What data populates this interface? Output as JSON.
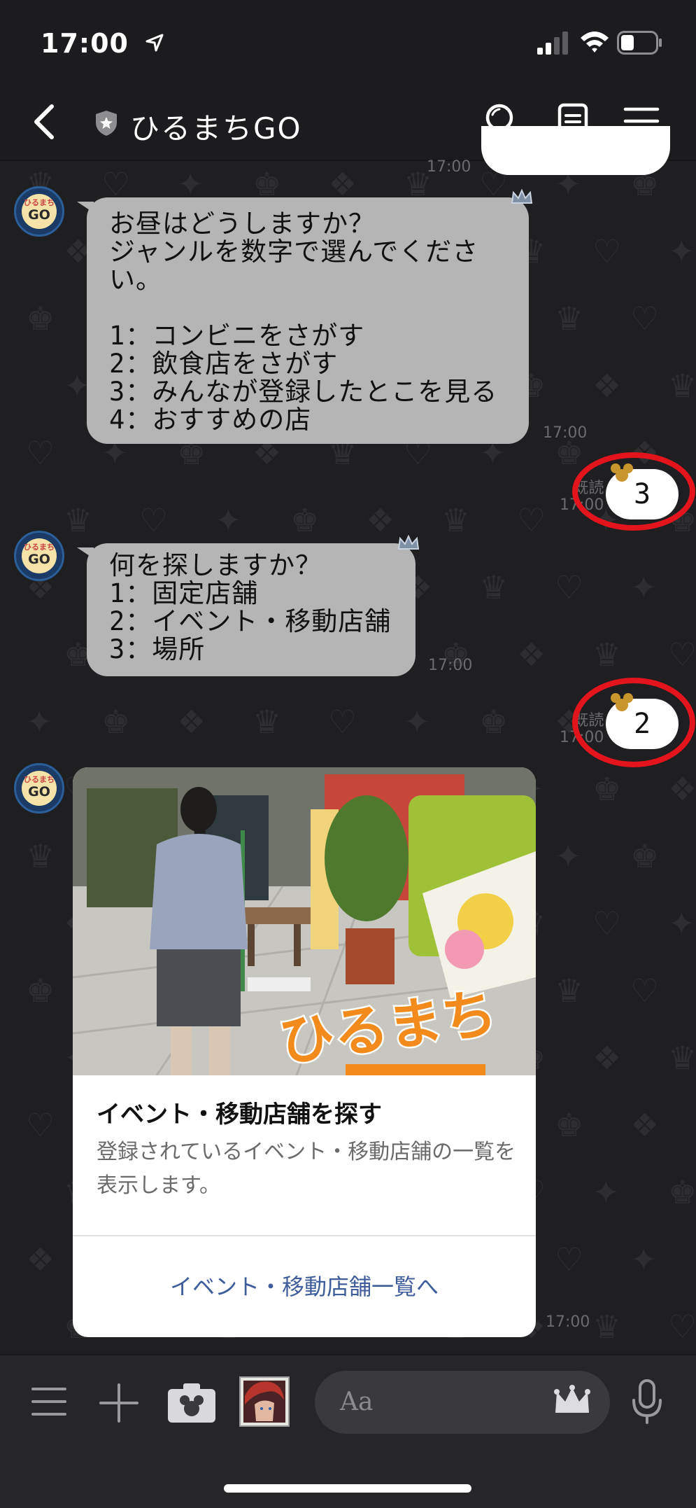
{
  "status": {
    "time": "17:00"
  },
  "header": {
    "title": "ひるまちGO"
  },
  "avatar": {
    "top_text": "ひるまち",
    "bottom_text": "GO"
  },
  "messages": {
    "partial_time": "17:00",
    "m1": {
      "lines": [
        "お昼はどうしますか？",
        "ジャンルを数字で選んでくださ",
        "い。",
        "",
        "1：コンビニをさがす",
        "2：飲食店をさがす",
        "3：みんなが登録したとこを見る",
        "4：おすすめの店"
      ],
      "time": "17:00"
    },
    "r1": {
      "text": "3",
      "read_label": "既読",
      "time": "17:00"
    },
    "m2": {
      "lines": [
        "何を探しますか？",
        "1：固定店舗",
        "2：イベント・移動店舗",
        "3：場所"
      ],
      "time": "17:00"
    },
    "r2": {
      "text": "2",
      "read_label": "既読",
      "time": "17:00"
    },
    "card": {
      "image_text": "ひるまち",
      "title": "イベント・移動店舗を探す",
      "desc": "登録されているイベント・移動店舗の一覧を表示します。",
      "action": "イベント・移動店舗一覧へ",
      "time": "17:00"
    }
  },
  "input": {
    "placeholder": "Aa"
  },
  "icons": [
    "location-arrow-icon",
    "signal-icon",
    "wifi-icon",
    "battery-icon",
    "back-chevron-icon",
    "official-shield-icon",
    "search-icon",
    "notes-icon",
    "menu-icon",
    "crown-icon",
    "hamburger-icon",
    "plus-icon",
    "camera-icon",
    "character-sticker-icon",
    "microphone-icon"
  ],
  "colors": {
    "background": "#1f1f21",
    "incoming_bubble": "#b5b5b5",
    "outgoing_bubble": "#ffffff",
    "highlight_ring": "#e4141c",
    "link": "#3e5d9a"
  }
}
